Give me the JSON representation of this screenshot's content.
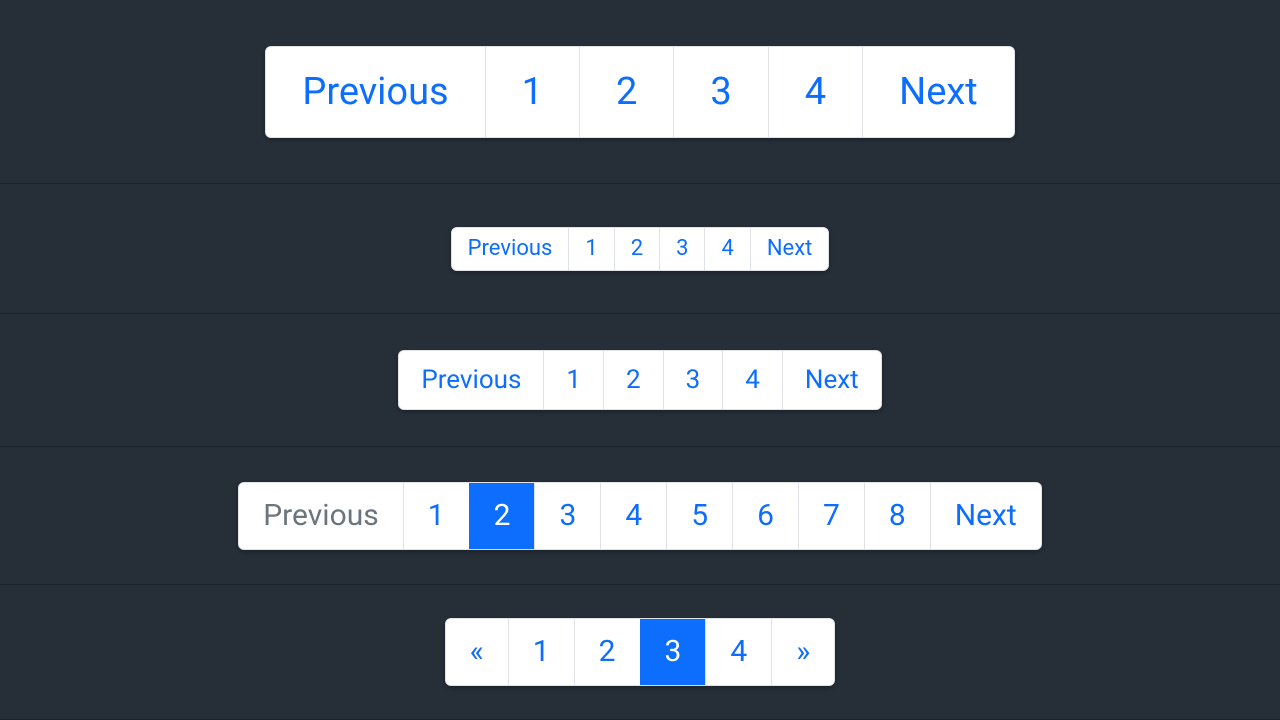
{
  "colors": {
    "link": "#0d6efd",
    "muted": "#6c757d",
    "border": "#dee2e6",
    "bg": "#262e38"
  },
  "rows": [
    {
      "size": "xl",
      "items": [
        {
          "label": "Previous",
          "role": "prev",
          "active": false,
          "disabled": false
        },
        {
          "label": "1",
          "role": "page",
          "active": false,
          "disabled": false
        },
        {
          "label": "2",
          "role": "page",
          "active": false,
          "disabled": false
        },
        {
          "label": "3",
          "role": "page",
          "active": false,
          "disabled": false
        },
        {
          "label": "4",
          "role": "page",
          "active": false,
          "disabled": false
        },
        {
          "label": "Next",
          "role": "next",
          "active": false,
          "disabled": false
        }
      ]
    },
    {
      "size": "sm",
      "items": [
        {
          "label": "Previous",
          "role": "prev",
          "active": false,
          "disabled": false
        },
        {
          "label": "1",
          "role": "page",
          "active": false,
          "disabled": false
        },
        {
          "label": "2",
          "role": "page",
          "active": false,
          "disabled": false
        },
        {
          "label": "3",
          "role": "page",
          "active": false,
          "disabled": false
        },
        {
          "label": "4",
          "role": "page",
          "active": false,
          "disabled": false
        },
        {
          "label": "Next",
          "role": "next",
          "active": false,
          "disabled": false
        }
      ]
    },
    {
      "size": "md",
      "items": [
        {
          "label": "Previous",
          "role": "prev",
          "active": false,
          "disabled": false
        },
        {
          "label": "1",
          "role": "page",
          "active": false,
          "disabled": false
        },
        {
          "label": "2",
          "role": "page",
          "active": false,
          "disabled": false
        },
        {
          "label": "3",
          "role": "page",
          "active": false,
          "disabled": false
        },
        {
          "label": "4",
          "role": "page",
          "active": false,
          "disabled": false
        },
        {
          "label": "Next",
          "role": "next",
          "active": false,
          "disabled": false
        }
      ]
    },
    {
      "size": "lg",
      "items": [
        {
          "label": "Previous",
          "role": "prev",
          "active": false,
          "disabled": true
        },
        {
          "label": "1",
          "role": "page",
          "active": false,
          "disabled": false
        },
        {
          "label": "2",
          "role": "page",
          "active": true,
          "disabled": false
        },
        {
          "label": "3",
          "role": "page",
          "active": false,
          "disabled": false
        },
        {
          "label": "4",
          "role": "page",
          "active": false,
          "disabled": false
        },
        {
          "label": "5",
          "role": "page",
          "active": false,
          "disabled": false
        },
        {
          "label": "6",
          "role": "page",
          "active": false,
          "disabled": false
        },
        {
          "label": "7",
          "role": "page",
          "active": false,
          "disabled": false
        },
        {
          "label": "8",
          "role": "page",
          "active": false,
          "disabled": false
        },
        {
          "label": "Next",
          "role": "next",
          "active": false,
          "disabled": false
        }
      ]
    },
    {
      "size": "lg2",
      "items": [
        {
          "label": "«",
          "role": "prev",
          "active": false,
          "disabled": false
        },
        {
          "label": "1",
          "role": "page",
          "active": false,
          "disabled": false
        },
        {
          "label": "2",
          "role": "page",
          "active": false,
          "disabled": false
        },
        {
          "label": "3",
          "role": "page",
          "active": true,
          "disabled": false
        },
        {
          "label": "4",
          "role": "page",
          "active": false,
          "disabled": false
        },
        {
          "label": "»",
          "role": "next",
          "active": false,
          "disabled": false
        }
      ]
    }
  ]
}
